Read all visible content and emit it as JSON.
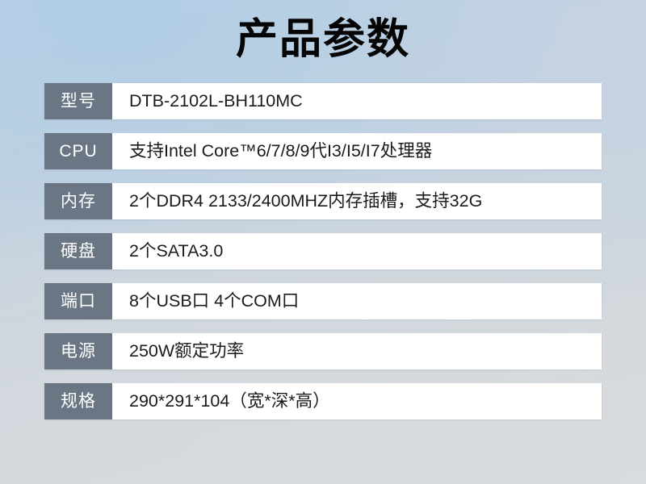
{
  "page": {
    "title": "产品参数",
    "background_top_left": "#bcd3e6",
    "background_bottom": "#dadddf"
  },
  "colors": {
    "label_cell": "#6b7684",
    "label_text": "#ffffff",
    "value_cell": "#ffffff",
    "value_text": "#1b1b1b",
    "title_text": "#050505"
  },
  "spec_table": {
    "rows": [
      {
        "label": "型号",
        "value": "DTB-2102L-BH110MC"
      },
      {
        "label": "CPU",
        "value": "支持Intel Core™6/7/8/9代I3/I5/I7处理器"
      },
      {
        "label": "内存",
        "value": "2个DDR4 2133/2400MHZ内存插槽，支持32G"
      },
      {
        "label": "硬盘",
        "value": "2个SATA3.0"
      },
      {
        "label": "端口",
        "value": "8个USB口 4个COM口"
      },
      {
        "label": "电源",
        "value": "250W额定功率"
      },
      {
        "label": "规格",
        "value": "290*291*104（宽*深*高）"
      }
    ]
  }
}
